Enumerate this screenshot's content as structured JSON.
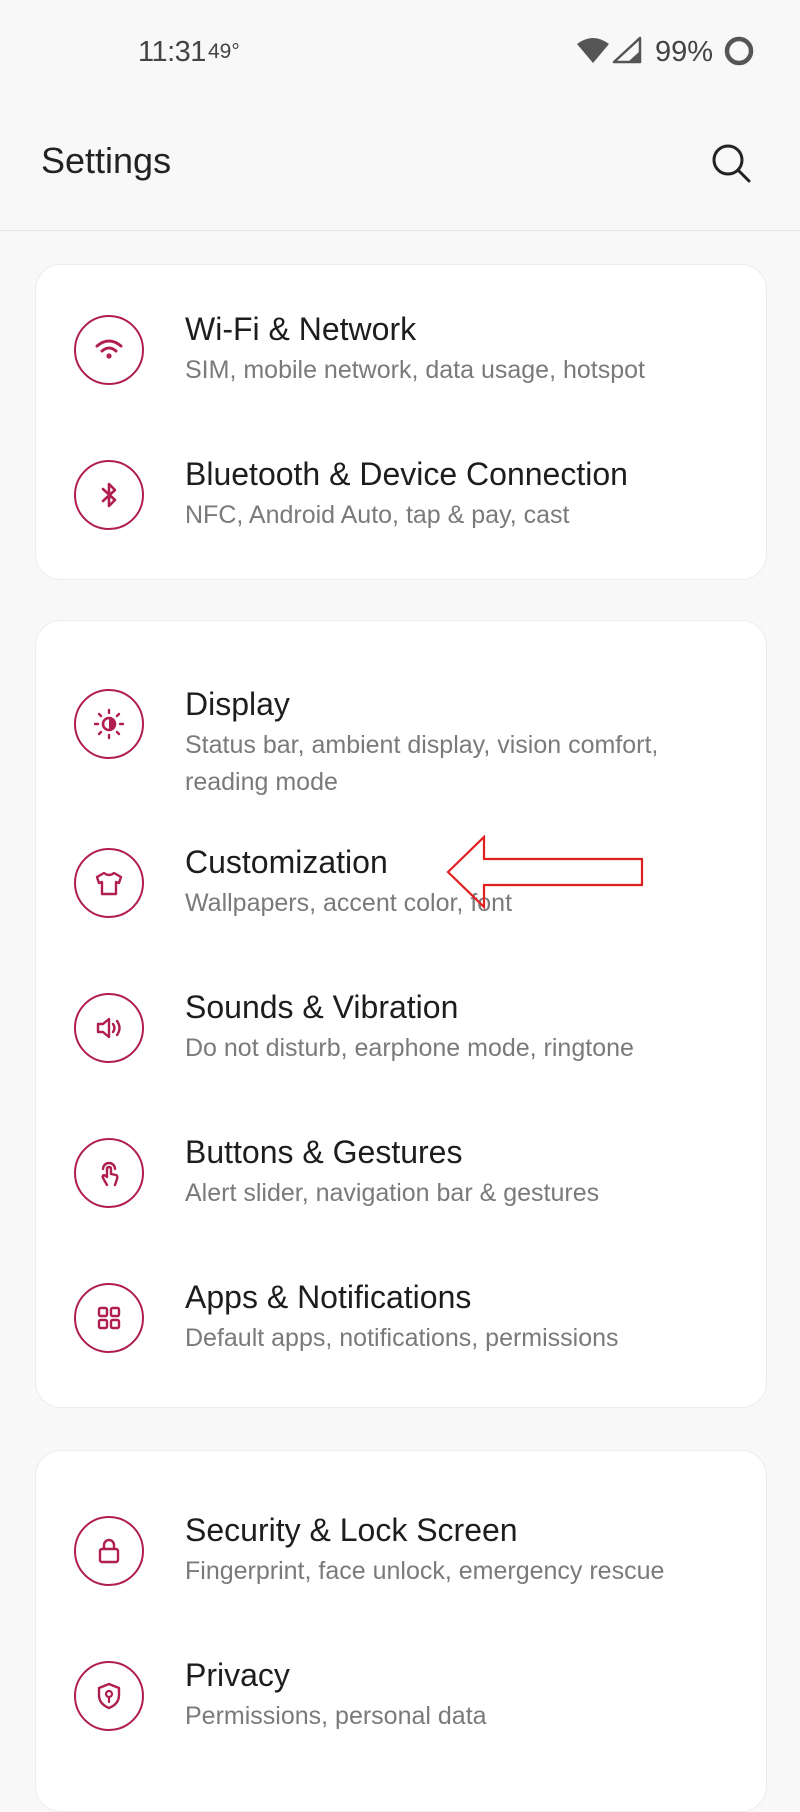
{
  "status_bar": {
    "time": "11:31",
    "temperature": "49°",
    "battery": "99%",
    "icons": [
      "wifi-icon",
      "cellular-signal-icon",
      "battery-icon"
    ]
  },
  "header": {
    "title": "Settings",
    "search_icon": "search-icon"
  },
  "theme": {
    "accent": "#b01e4d",
    "annotation_arrow": "#e0201f"
  },
  "sections": [
    {
      "items": [
        {
          "title": "Wi-Fi & Network",
          "subtitle": "SIM, mobile network, data usage, hotspot",
          "icon": "wifi-icon"
        },
        {
          "title": "Bluetooth & Device Connection",
          "subtitle": "NFC, Android Auto, tap & pay, cast",
          "icon": "bluetooth-icon"
        }
      ]
    },
    {
      "items": [
        {
          "title": "Display",
          "subtitle": "Status bar, ambient display, vision comfort, reading mode",
          "icon": "brightness-icon"
        },
        {
          "title": "Customization",
          "subtitle": "Wallpapers, accent color, font",
          "icon": "t-shirt-icon"
        },
        {
          "title": "Sounds & Vibration",
          "subtitle": "Do not disturb, earphone mode, ringtone",
          "icon": "speaker-icon"
        },
        {
          "title": "Buttons & Gestures",
          "subtitle": "Alert slider, navigation bar & gestures",
          "icon": "gesture-icon"
        },
        {
          "title": "Apps & Notifications",
          "subtitle": "Default apps, notifications, permissions",
          "icon": "apps-grid-icon"
        }
      ]
    },
    {
      "items": [
        {
          "title": "Security & Lock Screen",
          "subtitle": "Fingerprint, face unlock, emergency rescue",
          "icon": "lock-icon"
        },
        {
          "title": "Privacy",
          "subtitle": "Permissions, personal data",
          "icon": "privacy-shield-icon"
        }
      ]
    }
  ]
}
